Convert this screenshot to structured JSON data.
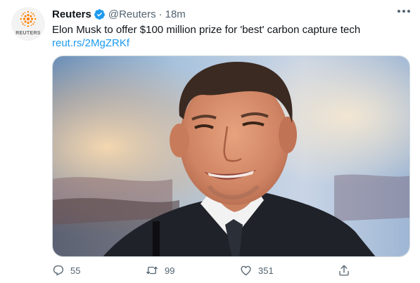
{
  "account": {
    "name": "Reuters",
    "handle": "@Reuters",
    "separator": "·",
    "time": "18m",
    "avatar_text": "REUTERS"
  },
  "tweet": {
    "text": "Elon Musk to offer $100 million prize for 'best' carbon capture tech",
    "link": "reut.rs/2MgZRKf"
  },
  "media": {
    "description": "photo-man-in-suit-smiling"
  },
  "actions": {
    "reply_count": "55",
    "retweet_count": "99",
    "like_count": "351"
  },
  "colors": {
    "link": "#1d9bf0",
    "muted": "#536471",
    "verified": "#1d9bf0",
    "reuters_orange": "#ff8000"
  }
}
